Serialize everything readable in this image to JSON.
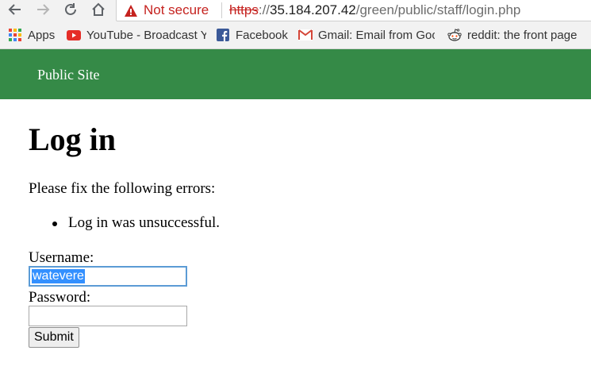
{
  "browser": {
    "security": {
      "label": "Not secure",
      "icon": "warning-triangle-icon"
    },
    "url": {
      "scheme": "https",
      "rest_sep": "://",
      "host": "35.184.207.42",
      "path": "/green/public/staff/login.php"
    },
    "bookmarks": [
      {
        "label": "Apps",
        "icon": "apps-grid-icon"
      },
      {
        "label": "YouTube - Broadcast Y",
        "icon": "youtube-icon"
      },
      {
        "label": "Facebook",
        "icon": "facebook-icon"
      },
      {
        "label": "Gmail: Email from Goo",
        "icon": "gmail-icon"
      },
      {
        "label": "reddit: the front page",
        "icon": "reddit-icon"
      }
    ]
  },
  "site": {
    "header_title": "Public Site",
    "page_title": "Log in",
    "errors_intro": "Please fix the following errors:",
    "errors": [
      "Log in was unsuccessful."
    ],
    "form": {
      "username_label": "Username:",
      "username_value": "watevere",
      "password_label": "Password:",
      "password_value": "",
      "submit_label": "Submit"
    }
  },
  "colors": {
    "header_green": "#358a47",
    "warning_red": "#c5221f",
    "focus_blue": "#5b9bd5",
    "selection_blue": "#3390ff"
  }
}
